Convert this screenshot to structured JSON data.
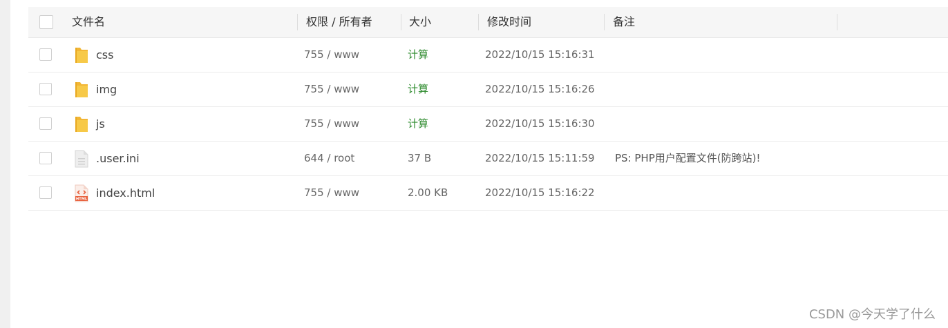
{
  "table": {
    "headers": {
      "name": "文件名",
      "permission": "权限 / 所有者",
      "size": "大小",
      "modified": "修改时间",
      "note": "备注"
    },
    "rows": [
      {
        "name": "css",
        "type": "folder",
        "permission": "755 / www",
        "size": "计算",
        "size_is_action": true,
        "modified": "2022/10/15 15:16:31",
        "note": ""
      },
      {
        "name": "img",
        "type": "folder",
        "permission": "755 / www",
        "size": "计算",
        "size_is_action": true,
        "modified": "2022/10/15 15:16:26",
        "note": ""
      },
      {
        "name": "js",
        "type": "folder",
        "permission": "755 / www",
        "size": "计算",
        "size_is_action": true,
        "modified": "2022/10/15 15:16:30",
        "note": ""
      },
      {
        "name": ".user.ini",
        "type": "text-file",
        "permission": "644 / root",
        "size": "37 B",
        "size_is_action": false,
        "modified": "2022/10/15 15:11:59",
        "note": "PS: PHP用户配置文件(防跨站)!"
      },
      {
        "name": "index.html",
        "type": "html-file",
        "permission": "755 / www",
        "size": "2.00 KB",
        "size_is_action": false,
        "modified": "2022/10/15 15:16:22",
        "note": ""
      }
    ]
  },
  "icons": {
    "folder": "folder-icon",
    "text-file": "text-file-icon",
    "html-file": "html-file-icon",
    "html_badge": "HTML"
  },
  "colors": {
    "calc_link": "#2e8b2e",
    "folder": "#f7c948",
    "html_icon": "#e8603c"
  },
  "watermark": "CSDN @今天学了什么"
}
